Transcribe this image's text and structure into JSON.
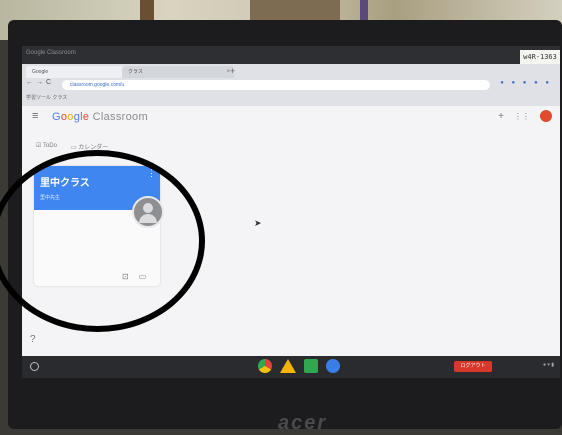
{
  "window": {
    "title": "Google Classroom"
  },
  "system_badge": "w4R-1363",
  "browser": {
    "tabs": [
      {
        "label": "Google"
      },
      {
        "label": "クラス"
      }
    ],
    "new_tab_icon": "plus-icon",
    "url": "classroom.google.com/u",
    "bookmarks": "学習ツール  クラス"
  },
  "classroom": {
    "logo_parts": [
      "G",
      "o",
      "o",
      "g",
      "l",
      "e",
      " Classroom"
    ],
    "subnav": {
      "todo": "ToDo",
      "calendar": "カレンダー"
    },
    "class_card": {
      "title": "里中クラス",
      "teacher": "里中先生"
    },
    "help_icon": "question-circle-icon"
  },
  "shelf": {
    "apps": [
      "chrome-icon",
      "drive-icon",
      "classroom-icon",
      "messages-icon"
    ],
    "logout_label": "ログアウト"
  },
  "laptop_brand": "acer",
  "colors": {
    "card_header": "#3f86f0",
    "logout": "#d9362c",
    "annotation_circle": "#000000"
  }
}
